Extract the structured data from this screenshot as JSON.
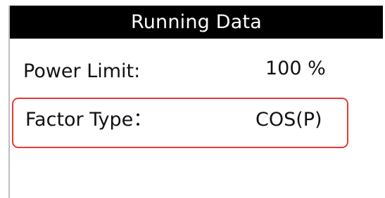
{
  "screen": {
    "title": "Running Data"
  },
  "rows": [
    {
      "label": "Power Limit:",
      "value": "100 %"
    },
    {
      "label": "Factor Type：",
      "value": "COS(P)"
    }
  ],
  "colors": {
    "title_bg": "#000000",
    "title_text": "#ffffff",
    "highlight_border": "#e53935"
  }
}
